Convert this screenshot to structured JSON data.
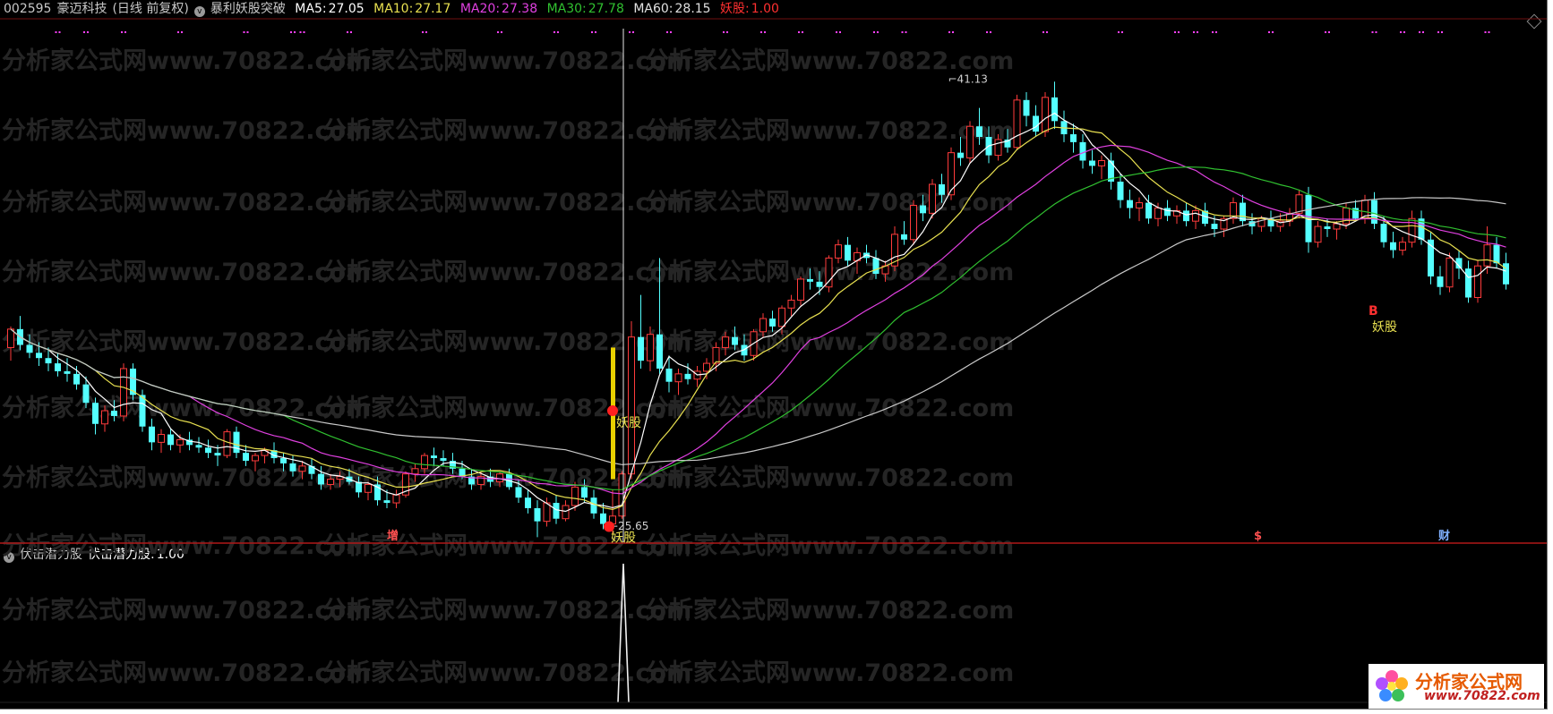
{
  "header": {
    "code": "002595",
    "stock_name": "豪迈科技",
    "period": "(日线 前复权)",
    "indicator": "暴利妖股突破",
    "ma5_label": "MA5:",
    "ma5_value": "27.05",
    "ma10_label": "MA10:",
    "ma10_value": "27.17",
    "ma20_label": "MA20:",
    "ma20_value": "27.38",
    "ma30_label": "MA30:",
    "ma30_value": "27.78",
    "ma60_label": "MA60:",
    "ma60_value": "28.15",
    "signal_label": "妖股:",
    "signal_value": "1.00"
  },
  "sub_header": {
    "title": "伏击潜力股",
    "value_label": "伏击潜力股:",
    "value": "1.00"
  },
  "annotations": {
    "high_label": "41.13",
    "low_label": "25.65",
    "signal_text": "妖股",
    "buy_letter": "B",
    "event_zeng": "增",
    "event_s": "$",
    "event_cai": "财"
  },
  "watermark": "分析家公式网www.70822.com",
  "logo": {
    "text": "分析家公式网",
    "url": "www.70822.com"
  },
  "colors": {
    "ma5": "#ffffff",
    "ma10": "#e8e050",
    "ma20": "#e040e0",
    "ma30": "#30c030",
    "ma60": "#c8c8c8",
    "up_candle": "#ff3b3b",
    "down_candle": "#54ffff",
    "signal": "#ff3030",
    "dots": "#ff40ff",
    "background": "#000000"
  },
  "chart_data": {
    "type": "candlestick",
    "title": "暴利妖股突破",
    "price_range": [
      25.0,
      42.5
    ],
    "x_count": 160,
    "notable": {
      "high": {
        "index": 101,
        "value": 41.13
      },
      "low": {
        "index": 60,
        "value": 25.65
      }
    },
    "ohlc": [
      [
        31.0,
        31.8,
        30.5,
        31.7
      ],
      [
        31.7,
        32.2,
        30.9,
        31.1
      ],
      [
        31.1,
        31.5,
        30.6,
        30.8
      ],
      [
        30.8,
        31.2,
        30.3,
        30.6
      ],
      [
        30.6,
        31.0,
        30.1,
        30.4
      ],
      [
        30.4,
        30.8,
        29.9,
        30.1
      ],
      [
        30.1,
        30.6,
        29.7,
        30.0
      ],
      [
        30.0,
        30.3,
        29.4,
        29.6
      ],
      [
        29.6,
        29.9,
        28.7,
        28.9
      ],
      [
        28.9,
        29.1,
        27.7,
        28.1
      ],
      [
        28.1,
        28.8,
        27.8,
        28.6
      ],
      [
        28.6,
        29.0,
        28.2,
        28.4
      ],
      [
        28.4,
        30.4,
        28.2,
        30.2
      ],
      [
        30.2,
        30.4,
        29.0,
        29.2
      ],
      [
        29.2,
        29.4,
        27.8,
        28.0
      ],
      [
        28.0,
        28.3,
        27.1,
        27.4
      ],
      [
        27.4,
        27.9,
        27.0,
        27.7
      ],
      [
        27.7,
        27.9,
        27.1,
        27.3
      ],
      [
        27.3,
        27.7,
        27.0,
        27.5
      ],
      [
        27.5,
        27.8,
        27.1,
        27.3
      ],
      [
        27.3,
        27.6,
        27.0,
        27.2
      ],
      [
        27.2,
        27.5,
        26.8,
        27.0
      ],
      [
        27.0,
        27.3,
        26.5,
        26.9
      ],
      [
        26.9,
        27.9,
        26.8,
        27.8
      ],
      [
        27.8,
        28.0,
        26.8,
        27.0
      ],
      [
        27.0,
        27.3,
        26.5,
        26.7
      ],
      [
        26.7,
        27.0,
        26.3,
        26.9
      ],
      [
        26.9,
        27.2,
        26.6,
        27.1
      ],
      [
        27.1,
        27.4,
        26.6,
        26.8
      ],
      [
        26.8,
        27.0,
        26.3,
        26.6
      ],
      [
        26.6,
        26.9,
        26.1,
        26.3
      ],
      [
        26.3,
        26.7,
        26.0,
        26.5
      ],
      [
        26.5,
        26.8,
        26.0,
        26.2
      ],
      [
        26.2,
        26.5,
        25.6,
        25.8
      ],
      [
        25.8,
        26.2,
        25.6,
        26.0
      ],
      [
        26.0,
        26.3,
        25.7,
        26.1
      ],
      [
        26.1,
        26.4,
        25.8,
        25.9
      ],
      [
        25.9,
        26.1,
        25.3,
        25.5
      ],
      [
        25.5,
        25.9,
        25.2,
        25.8
      ],
      [
        25.8,
        26.1,
        25.0,
        25.2
      ],
      [
        25.2,
        25.6,
        24.9,
        25.1
      ],
      [
        25.1,
        25.6,
        24.9,
        25.4
      ],
      [
        25.4,
        26.3,
        25.3,
        26.2
      ],
      [
        26.2,
        26.6,
        25.9,
        26.4
      ],
      [
        26.4,
        27.0,
        26.2,
        26.9
      ],
      [
        26.9,
        27.2,
        26.5,
        26.8
      ],
      [
        26.8,
        27.1,
        26.5,
        26.7
      ],
      [
        26.7,
        27.0,
        26.2,
        26.4
      ],
      [
        26.4,
        26.7,
        26.0,
        26.1
      ],
      [
        26.1,
        26.4,
        25.6,
        25.8
      ],
      [
        25.8,
        26.3,
        25.6,
        26.1
      ],
      [
        26.1,
        26.4,
        25.7,
        25.9
      ],
      [
        25.9,
        26.3,
        25.7,
        26.2
      ],
      [
        26.2,
        26.4,
        25.6,
        25.7
      ],
      [
        25.7,
        26.0,
        25.1,
        25.3
      ],
      [
        25.3,
        25.6,
        24.7,
        24.9
      ],
      [
        24.9,
        25.2,
        23.8,
        24.4
      ],
      [
        24.4,
        25.3,
        24.2,
        25.1
      ],
      [
        25.1,
        25.4,
        24.3,
        24.5
      ],
      [
        24.5,
        25.2,
        24.4,
        25.0
      ],
      [
        25.0,
        25.9,
        24.8,
        25.7
      ],
      [
        25.7,
        26.0,
        25.1,
        25.3
      ],
      [
        25.3,
        25.6,
        24.5,
        24.7
      ],
      [
        24.7,
        25.1,
        24.1,
        24.3
      ],
      [
        24.3,
        25.6,
        23.9,
        24.6
      ],
      [
        24.6,
        26.3,
        24.5,
        26.2
      ],
      [
        26.2,
        32.0,
        26.0,
        31.4
      ],
      [
        31.4,
        33.0,
        30.2,
        30.5
      ],
      [
        30.5,
        31.8,
        30.1,
        31.5
      ],
      [
        31.5,
        34.4,
        30.0,
        30.2
      ],
      [
        30.2,
        30.7,
        29.3,
        29.7
      ],
      [
        29.7,
        30.2,
        29.2,
        30.0
      ],
      [
        30.0,
        30.4,
        29.6,
        29.8
      ],
      [
        29.8,
        30.3,
        29.5,
        30.1
      ],
      [
        30.1,
        30.6,
        29.8,
        30.4
      ],
      [
        30.4,
        31.2,
        30.1,
        31.0
      ],
      [
        31.0,
        31.6,
        30.7,
        31.4
      ],
      [
        31.4,
        31.8,
        30.9,
        31.1
      ],
      [
        31.1,
        31.5,
        30.5,
        30.7
      ],
      [
        30.7,
        31.7,
        30.5,
        31.6
      ],
      [
        31.6,
        32.3,
        31.4,
        32.1
      ],
      [
        32.1,
        32.4,
        31.6,
        31.8
      ],
      [
        31.8,
        32.6,
        31.5,
        32.5
      ],
      [
        32.5,
        33.0,
        32.2,
        32.8
      ],
      [
        32.8,
        33.7,
        32.6,
        33.6
      ],
      [
        33.6,
        34.0,
        33.2,
        33.5
      ],
      [
        33.5,
        33.9,
        33.0,
        33.3
      ],
      [
        33.3,
        34.5,
        33.1,
        34.4
      ],
      [
        34.4,
        35.1,
        34.2,
        34.9
      ],
      [
        34.9,
        35.2,
        34.1,
        34.3
      ],
      [
        34.3,
        34.8,
        33.8,
        34.6
      ],
      [
        34.6,
        34.9,
        34.2,
        34.4
      ],
      [
        34.4,
        34.7,
        33.6,
        33.8
      ],
      [
        33.8,
        34.3,
        33.5,
        34.1
      ],
      [
        34.1,
        35.6,
        33.9,
        35.3
      ],
      [
        35.3,
        35.8,
        34.9,
        35.1
      ],
      [
        35.1,
        36.6,
        34.9,
        36.4
      ],
      [
        36.4,
        36.8,
        35.8,
        36.1
      ],
      [
        36.1,
        37.4,
        35.9,
        37.2
      ],
      [
        37.2,
        37.6,
        36.5,
        36.8
      ],
      [
        36.8,
        38.6,
        36.6,
        38.4
      ],
      [
        38.4,
        39.0,
        37.9,
        38.2
      ],
      [
        38.2,
        39.6,
        38.0,
        39.4
      ],
      [
        39.4,
        40.1,
        38.7,
        39.0
      ],
      [
        39.0,
        39.4,
        38.0,
        38.3
      ],
      [
        38.3,
        39.1,
        38.1,
        38.9
      ],
      [
        38.9,
        39.3,
        38.4,
        38.6
      ],
      [
        38.6,
        40.6,
        38.5,
        40.4
      ],
      [
        40.4,
        40.7,
        39.4,
        39.8
      ],
      [
        39.8,
        40.2,
        39.0,
        39.2
      ],
      [
        39.2,
        40.7,
        39.0,
        40.5
      ],
      [
        40.5,
        41.1,
        39.3,
        39.6
      ],
      [
        39.6,
        40.0,
        38.8,
        39.1
      ],
      [
        39.1,
        39.5,
        38.4,
        38.8
      ],
      [
        38.8,
        39.1,
        37.8,
        38.1
      ],
      [
        38.1,
        38.5,
        37.6,
        37.9
      ],
      [
        37.9,
        38.3,
        37.4,
        38.1
      ],
      [
        38.1,
        38.4,
        37.0,
        37.3
      ],
      [
        37.3,
        37.6,
        36.3,
        36.6
      ],
      [
        36.6,
        37.0,
        35.9,
        36.3
      ],
      [
        36.3,
        36.7,
        35.8,
        36.5
      ],
      [
        36.5,
        36.8,
        35.7,
        35.9
      ],
      [
        35.9,
        36.5,
        35.6,
        36.3
      ],
      [
        36.3,
        36.6,
        35.8,
        36.0
      ],
      [
        36.0,
        36.4,
        35.7,
        36.2
      ],
      [
        36.2,
        36.5,
        35.6,
        35.8
      ],
      [
        35.8,
        36.4,
        35.5,
        36.2
      ],
      [
        36.2,
        36.5,
        35.6,
        35.7
      ],
      [
        35.7,
        36.0,
        35.2,
        35.5
      ],
      [
        35.5,
        36.0,
        35.2,
        35.9
      ],
      [
        35.9,
        36.7,
        35.7,
        36.5
      ],
      [
        36.5,
        36.8,
        35.6,
        35.8
      ],
      [
        35.8,
        36.1,
        35.3,
        35.6
      ],
      [
        35.6,
        36.0,
        35.4,
        35.9
      ],
      [
        35.9,
        36.2,
        35.4,
        35.6
      ],
      [
        35.6,
        36.1,
        35.4,
        35.8
      ],
      [
        35.8,
        36.3,
        35.6,
        36.1
      ],
      [
        36.1,
        37.0,
        35.9,
        36.8
      ],
      [
        36.8,
        37.1,
        34.6,
        35.0
      ],
      [
        35.0,
        35.8,
        34.8,
        35.6
      ],
      [
        35.6,
        35.9,
        35.2,
        35.5
      ],
      [
        35.5,
        35.8,
        35.1,
        35.7
      ],
      [
        35.7,
        36.5,
        35.5,
        36.3
      ],
      [
        36.3,
        36.6,
        35.8,
        35.9
      ],
      [
        35.9,
        36.8,
        35.7,
        36.6
      ],
      [
        36.6,
        36.9,
        35.5,
        35.7
      ],
      [
        35.7,
        36.0,
        34.8,
        35.0
      ],
      [
        35.0,
        35.4,
        34.4,
        34.7
      ],
      [
        34.7,
        35.2,
        34.5,
        35.0
      ],
      [
        35.0,
        36.2,
        34.8,
        35.9
      ],
      [
        35.9,
        36.2,
        34.9,
        35.1
      ],
      [
        35.1,
        35.4,
        33.4,
        33.7
      ],
      [
        33.7,
        34.1,
        33.0,
        33.3
      ],
      [
        33.3,
        34.6,
        33.1,
        34.4
      ],
      [
        34.4,
        34.7,
        33.6,
        34.0
      ],
      [
        34.0,
        34.3,
        32.7,
        32.9
      ],
      [
        32.9,
        34.3,
        32.7,
        34.1
      ],
      [
        34.1,
        35.6,
        33.8,
        34.9
      ],
      [
        34.9,
        35.2,
        34.0,
        34.2
      ],
      [
        34.2,
        34.6,
        33.2,
        33.4
      ]
    ],
    "ma_series": [
      {
        "name": "MA5",
        "color": "#ffffff"
      },
      {
        "name": "MA10",
        "color": "#e8e050"
      },
      {
        "name": "MA20",
        "color": "#e040e0"
      },
      {
        "name": "MA30",
        "color": "#30c030"
      },
      {
        "name": "MA60",
        "color": "#c8c8c8"
      }
    ],
    "signal_pane": {
      "name": "伏击潜力股",
      "range": [
        0,
        1
      ],
      "spike_index": 65,
      "spike_value": 1.0
    }
  }
}
